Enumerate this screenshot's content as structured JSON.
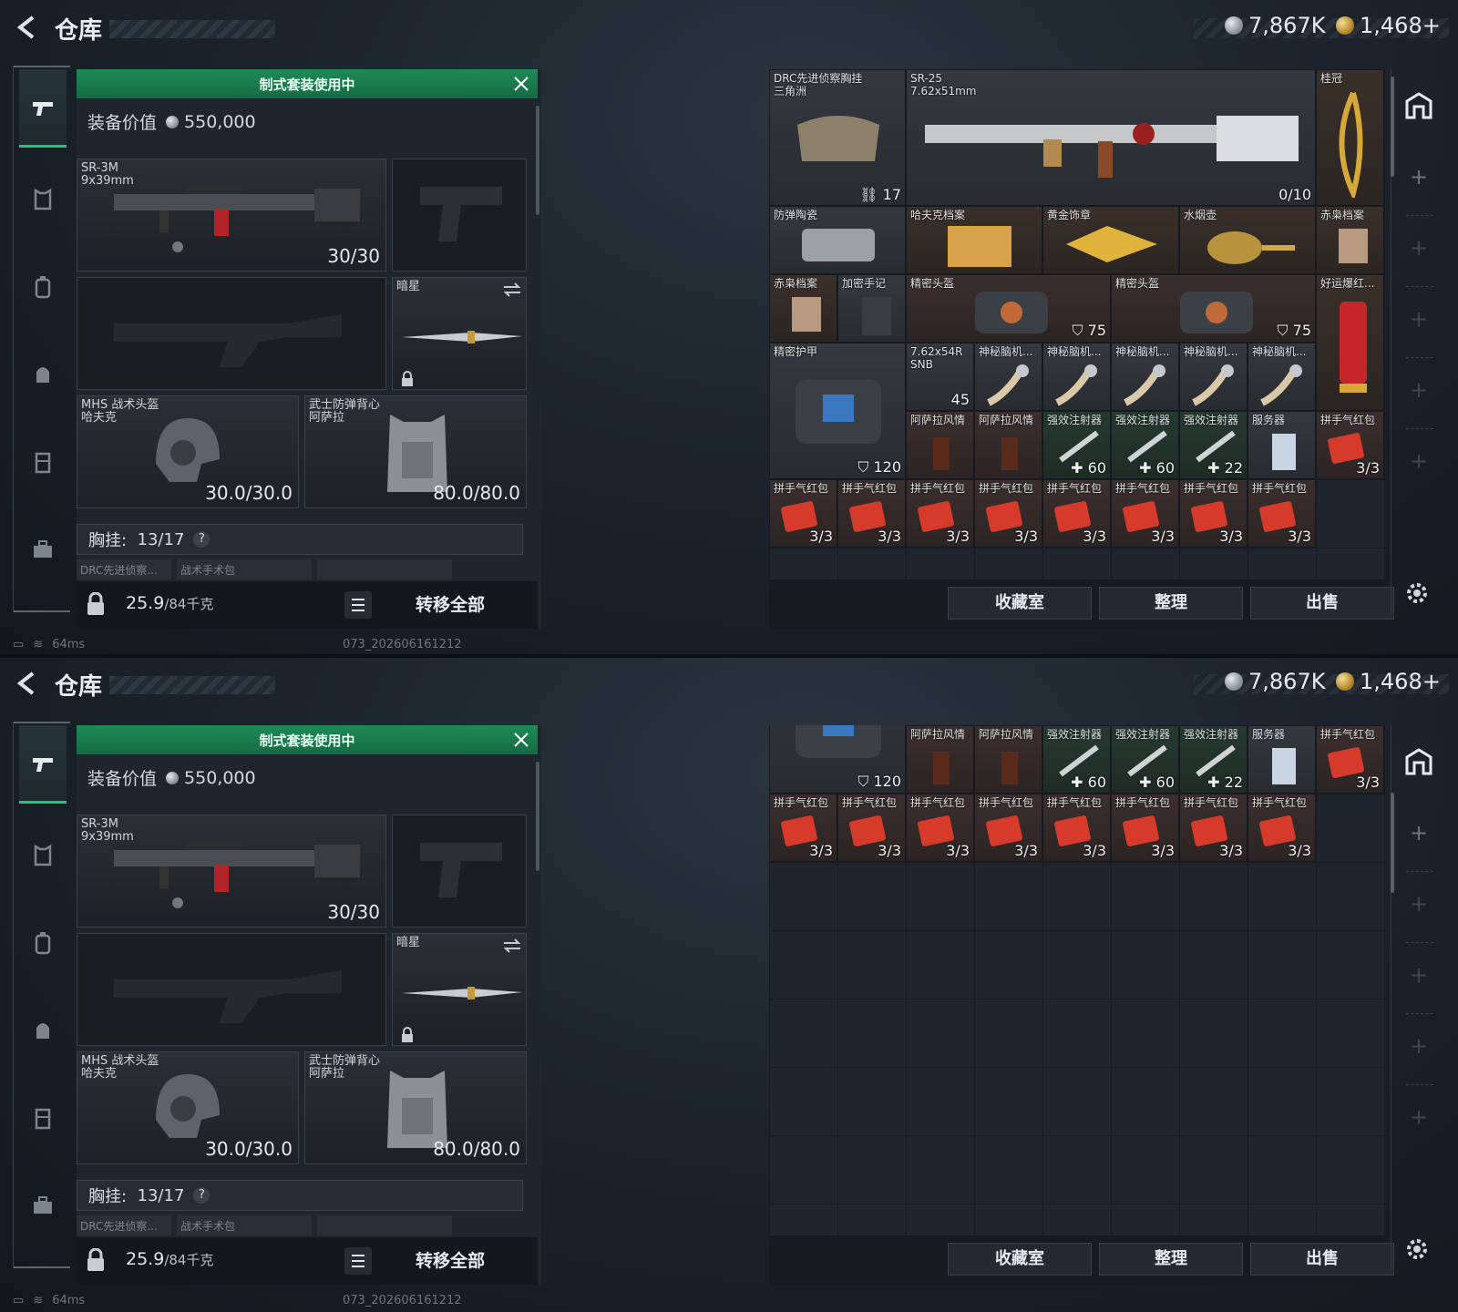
{
  "header": {
    "title": "仓库",
    "currency_silver": "7,867K",
    "currency_gold": "1,468+"
  },
  "nav": {
    "items": [
      "weapons-icon",
      "armor-icon",
      "backpack-icon",
      "chest-rig-icon",
      "container-icon",
      "toolbox-icon"
    ]
  },
  "loadout": {
    "banner": "制式套装使用中",
    "value_label": "装备价值",
    "value": "550,000",
    "primary": {
      "name": "SR-3M",
      "sub": "9x39mm",
      "ammo": "30/30"
    },
    "melee": {
      "name": "暗星"
    },
    "helmet": {
      "name": "MHS 战术头盔",
      "sub": "哈夫克",
      "durability": "30.0/30.0"
    },
    "armor": {
      "name": "武士防弹背心",
      "sub": "阿萨拉",
      "durability": "80.0/80.0"
    },
    "chest_label": "胸挂:",
    "chest_value": "13/17",
    "chest_help": "?",
    "chest_items": [
      "DRC先进侦察...",
      "战术手术包"
    ],
    "chest_sub": "三角洲",
    "weight": "25.9",
    "weight_max": "/84千克",
    "transfer_all": "转移全部"
  },
  "stash": {
    "items": [
      {
        "name": "DRC先进侦察胸挂\n三角洲",
        "val": "17"
      },
      {
        "name": "SR-25\n7.62x51mm",
        "val": "0/10"
      },
      {
        "name": "桂冠",
        "val": ""
      },
      {
        "name": "防弹陶瓷",
        "val": ""
      },
      {
        "name": "哈夫克档案",
        "val": ""
      },
      {
        "name": "黄金饰章",
        "val": ""
      },
      {
        "name": "水烟壶",
        "val": ""
      },
      {
        "name": "赤枭档案",
        "val": ""
      },
      {
        "name": "赤枭档案",
        "val": ""
      },
      {
        "name": "加密手记",
        "val": ""
      },
      {
        "name": "精密头盔",
        "val": "75"
      },
      {
        "name": "精密头盔",
        "val": "75"
      },
      {
        "name": "好运爆红...",
        "val": ""
      },
      {
        "name": "精密护甲",
        "val": "120"
      },
      {
        "name": "7.62x54R\nSNB",
        "val": "45"
      },
      {
        "name": "神秘脑机...",
        "val": ""
      },
      {
        "name": "阿萨拉风情",
        "val": ""
      },
      {
        "name": "强效注射器",
        "val": "60"
      },
      {
        "name": "强效注射器",
        "val": "22"
      },
      {
        "name": "服务器",
        "val": ""
      },
      {
        "name": "拼手气红包",
        "val": "3/3"
      }
    ],
    "btn_collection": "收藏室",
    "btn_sort": "整理",
    "btn_sell": "出售"
  },
  "status": {
    "ping": "64ms",
    "build": "073_202606161212"
  }
}
